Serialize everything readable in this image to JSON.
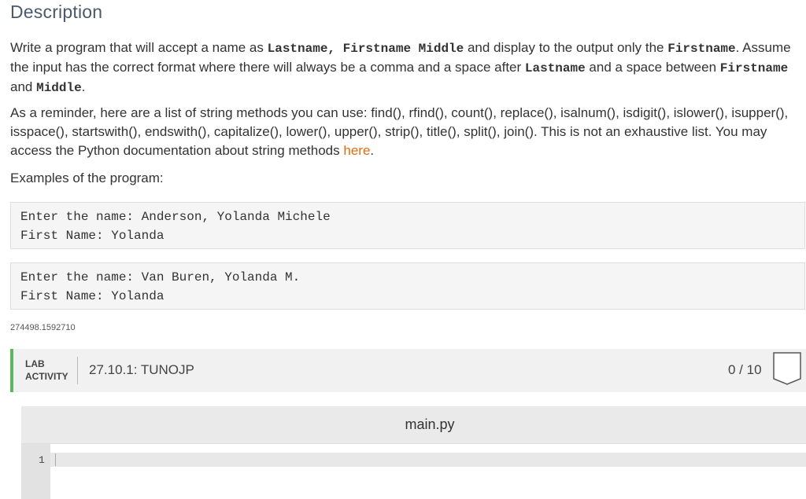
{
  "description": {
    "heading": "Description",
    "p1": {
      "t1": "Write a program that will accept a name as ",
      "c1": "Lastname, Firstname Middle",
      "t2": " and display to the output only the ",
      "c2": "Firstname",
      "t3": ". Assume the input has the correct format where there will always be a comma and a space after ",
      "c3": "Lastname",
      "t4": " and a space between ",
      "c4": "Firstname",
      "t5": " and ",
      "c5": "Middle",
      "t6": "."
    },
    "p2": {
      "text": "As a reminder, here are a list of string methods you can use: find(), rfind(), count(), replace(), isalnum(), isdigit(), islower(), isupper(), isspace(), startswith(), endswith(), capitalize(), lower(), upper(), strip(), title(), split(), join(). This is not an exhaustive list. You may access the Python documentation about string methods ",
      "link": "here",
      "end": "."
    },
    "p3": "Examples of the program:"
  },
  "examples": [
    {
      "line1": "Enter the name: Anderson, Yolanda Michele",
      "line2": "First Name: Yolanda"
    },
    {
      "line1": "Enter the name: Van Buren, Yolanda M.",
      "line2": "First Name: Yolanda"
    }
  ],
  "activity_id": "274498.1592710",
  "lab": {
    "label_line1": "LAB",
    "label_line2": "ACTIVITY",
    "title": "27.10.1: TUNOJP",
    "score": "0 / 10",
    "accent_color": "#5cb85c"
  },
  "editor": {
    "filename": "main.py",
    "line_number": "1"
  },
  "colors": {
    "link": "#e46c0a",
    "heading": "#4a5a6a"
  }
}
